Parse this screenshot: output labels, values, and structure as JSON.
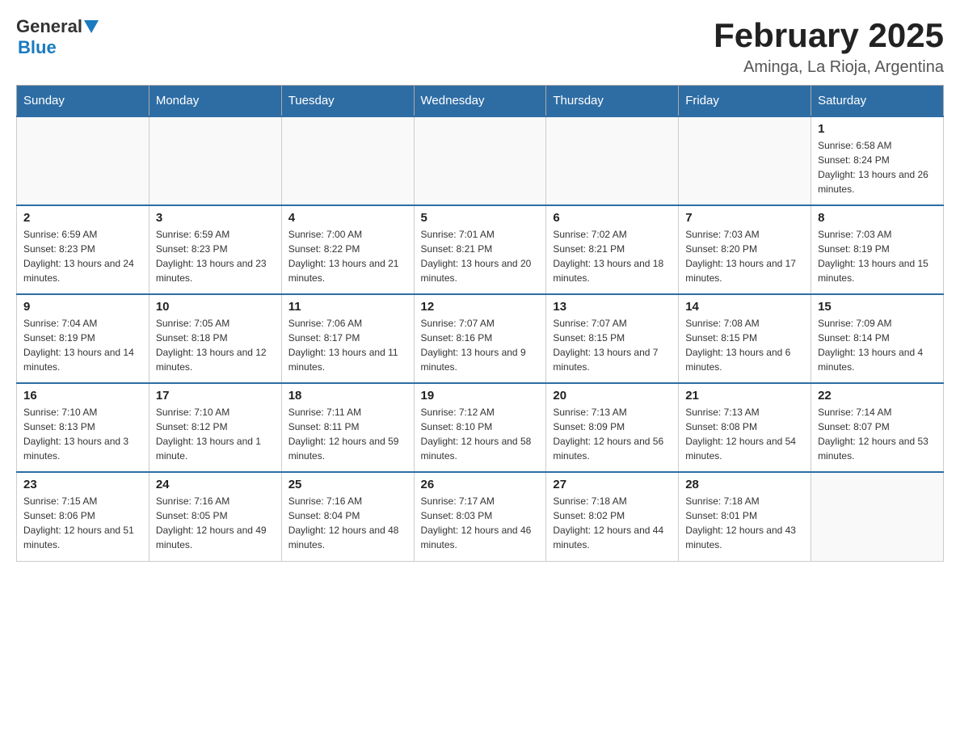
{
  "header": {
    "logo_general": "General",
    "logo_blue": "Blue",
    "month_title": "February 2025",
    "location": "Aminga, La Rioja, Argentina"
  },
  "weekdays": [
    "Sunday",
    "Monday",
    "Tuesday",
    "Wednesday",
    "Thursday",
    "Friday",
    "Saturday"
  ],
  "weeks": [
    {
      "days": [
        {
          "num": "",
          "info": ""
        },
        {
          "num": "",
          "info": ""
        },
        {
          "num": "",
          "info": ""
        },
        {
          "num": "",
          "info": ""
        },
        {
          "num": "",
          "info": ""
        },
        {
          "num": "",
          "info": ""
        },
        {
          "num": "1",
          "info": "Sunrise: 6:58 AM\nSunset: 8:24 PM\nDaylight: 13 hours and 26 minutes."
        }
      ]
    },
    {
      "days": [
        {
          "num": "2",
          "info": "Sunrise: 6:59 AM\nSunset: 8:23 PM\nDaylight: 13 hours and 24 minutes."
        },
        {
          "num": "3",
          "info": "Sunrise: 6:59 AM\nSunset: 8:23 PM\nDaylight: 13 hours and 23 minutes."
        },
        {
          "num": "4",
          "info": "Sunrise: 7:00 AM\nSunset: 8:22 PM\nDaylight: 13 hours and 21 minutes."
        },
        {
          "num": "5",
          "info": "Sunrise: 7:01 AM\nSunset: 8:21 PM\nDaylight: 13 hours and 20 minutes."
        },
        {
          "num": "6",
          "info": "Sunrise: 7:02 AM\nSunset: 8:21 PM\nDaylight: 13 hours and 18 minutes."
        },
        {
          "num": "7",
          "info": "Sunrise: 7:03 AM\nSunset: 8:20 PM\nDaylight: 13 hours and 17 minutes."
        },
        {
          "num": "8",
          "info": "Sunrise: 7:03 AM\nSunset: 8:19 PM\nDaylight: 13 hours and 15 minutes."
        }
      ]
    },
    {
      "days": [
        {
          "num": "9",
          "info": "Sunrise: 7:04 AM\nSunset: 8:19 PM\nDaylight: 13 hours and 14 minutes."
        },
        {
          "num": "10",
          "info": "Sunrise: 7:05 AM\nSunset: 8:18 PM\nDaylight: 13 hours and 12 minutes."
        },
        {
          "num": "11",
          "info": "Sunrise: 7:06 AM\nSunset: 8:17 PM\nDaylight: 13 hours and 11 minutes."
        },
        {
          "num": "12",
          "info": "Sunrise: 7:07 AM\nSunset: 8:16 PM\nDaylight: 13 hours and 9 minutes."
        },
        {
          "num": "13",
          "info": "Sunrise: 7:07 AM\nSunset: 8:15 PM\nDaylight: 13 hours and 7 minutes."
        },
        {
          "num": "14",
          "info": "Sunrise: 7:08 AM\nSunset: 8:15 PM\nDaylight: 13 hours and 6 minutes."
        },
        {
          "num": "15",
          "info": "Sunrise: 7:09 AM\nSunset: 8:14 PM\nDaylight: 13 hours and 4 minutes."
        }
      ]
    },
    {
      "days": [
        {
          "num": "16",
          "info": "Sunrise: 7:10 AM\nSunset: 8:13 PM\nDaylight: 13 hours and 3 minutes."
        },
        {
          "num": "17",
          "info": "Sunrise: 7:10 AM\nSunset: 8:12 PM\nDaylight: 13 hours and 1 minute."
        },
        {
          "num": "18",
          "info": "Sunrise: 7:11 AM\nSunset: 8:11 PM\nDaylight: 12 hours and 59 minutes."
        },
        {
          "num": "19",
          "info": "Sunrise: 7:12 AM\nSunset: 8:10 PM\nDaylight: 12 hours and 58 minutes."
        },
        {
          "num": "20",
          "info": "Sunrise: 7:13 AM\nSunset: 8:09 PM\nDaylight: 12 hours and 56 minutes."
        },
        {
          "num": "21",
          "info": "Sunrise: 7:13 AM\nSunset: 8:08 PM\nDaylight: 12 hours and 54 minutes."
        },
        {
          "num": "22",
          "info": "Sunrise: 7:14 AM\nSunset: 8:07 PM\nDaylight: 12 hours and 53 minutes."
        }
      ]
    },
    {
      "days": [
        {
          "num": "23",
          "info": "Sunrise: 7:15 AM\nSunset: 8:06 PM\nDaylight: 12 hours and 51 minutes."
        },
        {
          "num": "24",
          "info": "Sunrise: 7:16 AM\nSunset: 8:05 PM\nDaylight: 12 hours and 49 minutes."
        },
        {
          "num": "25",
          "info": "Sunrise: 7:16 AM\nSunset: 8:04 PM\nDaylight: 12 hours and 48 minutes."
        },
        {
          "num": "26",
          "info": "Sunrise: 7:17 AM\nSunset: 8:03 PM\nDaylight: 12 hours and 46 minutes."
        },
        {
          "num": "27",
          "info": "Sunrise: 7:18 AM\nSunset: 8:02 PM\nDaylight: 12 hours and 44 minutes."
        },
        {
          "num": "28",
          "info": "Sunrise: 7:18 AM\nSunset: 8:01 PM\nDaylight: 12 hours and 43 minutes."
        },
        {
          "num": "",
          "info": ""
        }
      ]
    }
  ]
}
